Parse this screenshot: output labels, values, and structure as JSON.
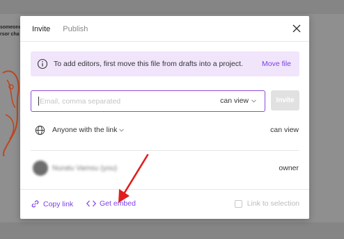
{
  "background": {
    "snippets": [
      "someone",
      "rsor cha"
    ]
  },
  "tabs": [
    {
      "label": "Invite",
      "active": true
    },
    {
      "label": "Publish",
      "active": false
    }
  ],
  "notice": {
    "text": "To add editors, first move this file from drafts into a project.",
    "link": "Move file",
    "icon": "info-icon"
  },
  "invite": {
    "placeholder": "Email, comma separated",
    "value": "",
    "permission": "can view",
    "button": "Invite"
  },
  "access": {
    "label": "Anyone with the link",
    "permission": "can view",
    "icon": "globe-icon"
  },
  "member": {
    "name": "Nuratu Vamsu (you)",
    "role": "owner"
  },
  "footer": {
    "copy_link": "Copy link",
    "get_embed": "Get embed",
    "link_to_selection": "Link to selection",
    "link_to_selection_checked": false
  },
  "colors": {
    "accent": "#7b3fe4",
    "notice_bg": "#f0e5fb",
    "arrow": "#e01e1e"
  }
}
